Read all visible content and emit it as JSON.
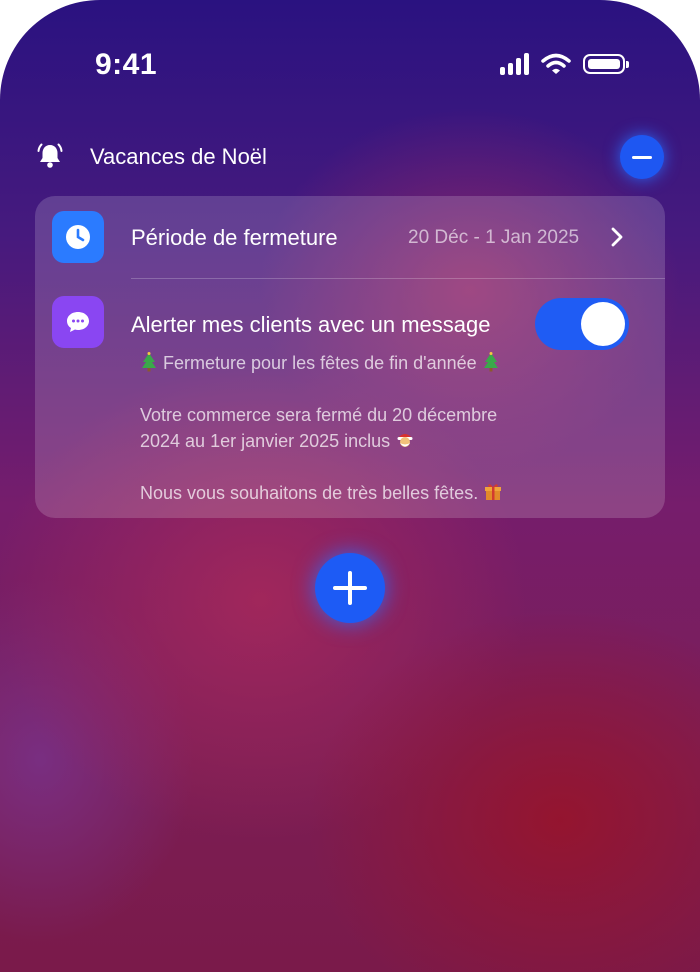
{
  "status_bar": {
    "time": "9:41",
    "icons": [
      "signal-icon",
      "wifi-icon",
      "battery-icon"
    ]
  },
  "header": {
    "title": "Vacances de Noël",
    "icon": "bell-icon",
    "action": "minus-icon"
  },
  "closure_period": {
    "label": "Période de fermeture",
    "value": "20 Déc - 1 Jan 2025",
    "icon": "clock-icon"
  },
  "client_alert": {
    "label": "Alerter mes clients avec un message",
    "icon": "message-bubble-icon",
    "enabled": true,
    "message": {
      "line1_text": "Fermeture pour les fêtes de fin d'année",
      "line2": "Votre commerce sera fermé du 20 décembre",
      "line3_text": "2024 au 1er janvier 2025 inclus",
      "line4_text": "Nous vous souhaitons de très belles fêtes."
    }
  },
  "add_button": {
    "icon": "plus-icon"
  },
  "colors": {
    "accent": "#1f5cf4",
    "clock_icon_bg": "#2b7bff",
    "message_icon_bg": "#8a46f2"
  }
}
